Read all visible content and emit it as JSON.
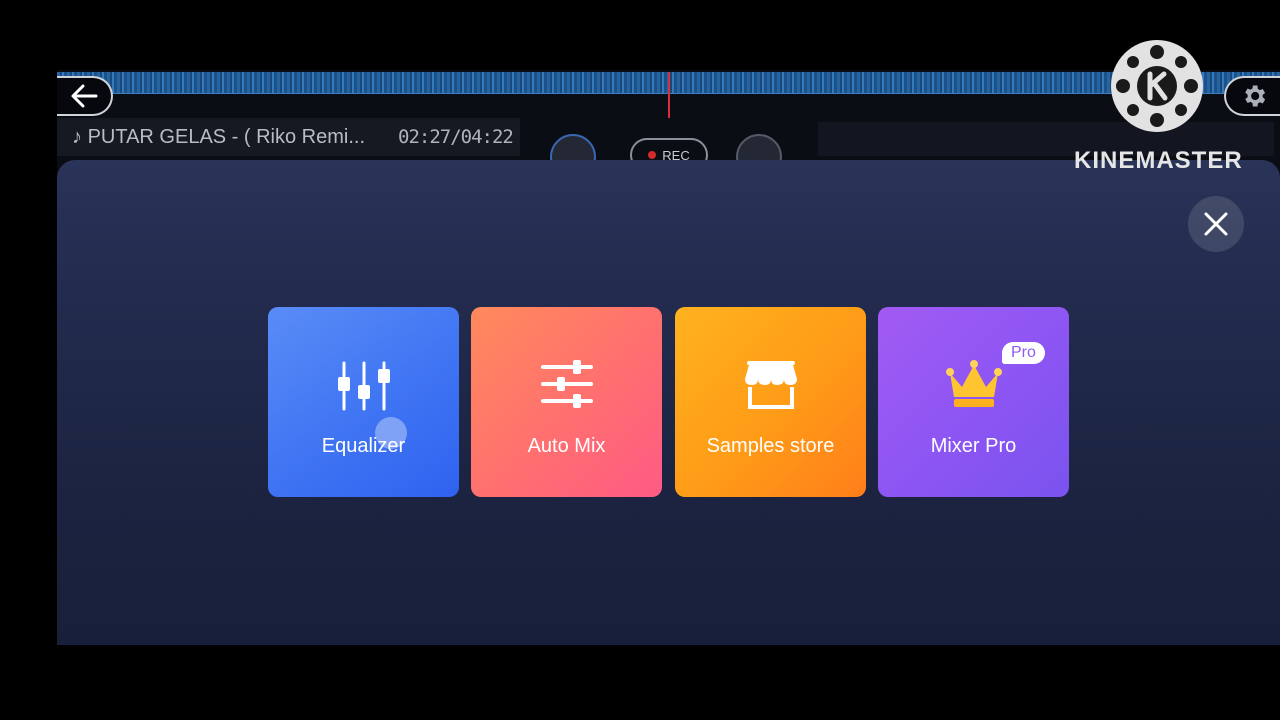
{
  "player": {
    "track_title": "PUTAR GELAS - ( Riko Remi...",
    "track_time": "02:27/04:22",
    "rec_label": "REC"
  },
  "menu": {
    "tiles": [
      {
        "label": "Equalizer",
        "icon": "equalizer-sliders-icon",
        "color": "#3f74f3"
      },
      {
        "label": "Auto Mix",
        "icon": "horizontal-sliders-icon",
        "color": "#ff6f6f"
      },
      {
        "label": "Samples store",
        "icon": "store-icon",
        "color": "#ff9b17"
      },
      {
        "label": "Mixer Pro",
        "icon": "crown-icon",
        "color": "#8c55f3",
        "badge": "Pro"
      }
    ]
  },
  "watermark": {
    "brand": "KINEMASTER"
  },
  "colors": {
    "overlay": "#222b4d",
    "accent_red": "#d8303a",
    "waveform": "#2a6fb0"
  }
}
